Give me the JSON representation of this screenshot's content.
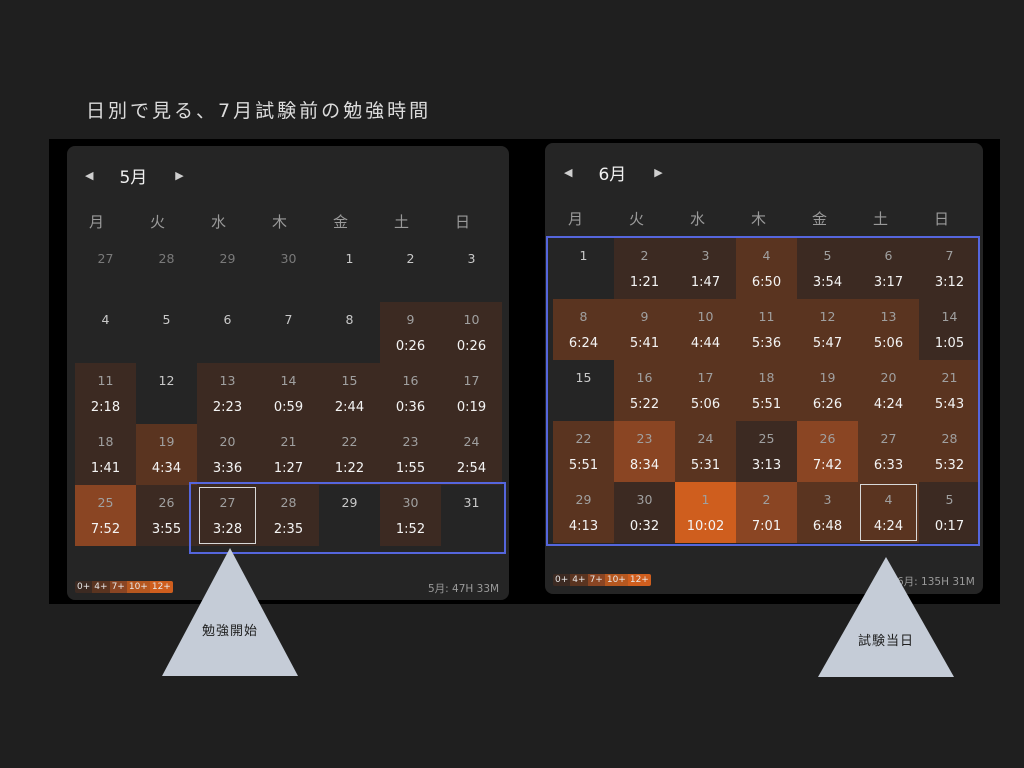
{
  "title": "日別で見る、7月試験前の勉強時間",
  "weekdays": [
    "月",
    "火",
    "水",
    "木",
    "金",
    "土",
    "日"
  ],
  "colors": {
    "lvl1": "#3c2a22",
    "lvl2": "#5a3420",
    "lvl3": "#8a4523",
    "lvl4": "#b5571f",
    "lvl5": "#cf5e1e",
    "highlight": "#5566dd",
    "triangle": "#c5ccd7"
  },
  "legend_labels": [
    "0+",
    "4+",
    "7+",
    "10+",
    "12+"
  ],
  "may": {
    "month_label": "5月",
    "total": "5月: 47H 33M",
    "weeks": [
      [
        {
          "d": "27",
          "o": true
        },
        {
          "d": "28",
          "o": true
        },
        {
          "d": "29",
          "o": true
        },
        {
          "d": "30",
          "o": true
        },
        {
          "d": "1"
        },
        {
          "d": "2"
        },
        {
          "d": "3"
        }
      ],
      [
        {
          "d": "4"
        },
        {
          "d": "5"
        },
        {
          "d": "6"
        },
        {
          "d": "7"
        },
        {
          "d": "8"
        },
        {
          "d": "9",
          "t": "0:26",
          "l": 1
        },
        {
          "d": "10",
          "t": "0:26",
          "l": 1
        }
      ],
      [
        {
          "d": "11",
          "t": "2:18",
          "l": 1
        },
        {
          "d": "12"
        },
        {
          "d": "13",
          "t": "2:23",
          "l": 1
        },
        {
          "d": "14",
          "t": "0:59",
          "l": 1
        },
        {
          "d": "15",
          "t": "2:44",
          "l": 1
        },
        {
          "d": "16",
          "t": "0:36",
          "l": 1
        },
        {
          "d": "17",
          "t": "0:19",
          "l": 1
        }
      ],
      [
        {
          "d": "18",
          "t": "1:41",
          "l": 1
        },
        {
          "d": "19",
          "t": "4:34",
          "l": 2
        },
        {
          "d": "20",
          "t": "3:36",
          "l": 1
        },
        {
          "d": "21",
          "t": "1:27",
          "l": 1
        },
        {
          "d": "22",
          "t": "1:22",
          "l": 1
        },
        {
          "d": "23",
          "t": "1:55",
          "l": 1
        },
        {
          "d": "24",
          "t": "2:54",
          "l": 1
        }
      ],
      [
        {
          "d": "25",
          "t": "7:52",
          "l": 3
        },
        {
          "d": "26",
          "t": "3:55",
          "l": 1
        },
        {
          "d": "27",
          "t": "3:28",
          "l": 1,
          "m": true
        },
        {
          "d": "28",
          "t": "2:35",
          "l": 1
        },
        {
          "d": "29"
        },
        {
          "d": "30",
          "t": "1:52",
          "l": 1
        },
        {
          "d": "31"
        }
      ]
    ]
  },
  "june": {
    "month_label": "6月",
    "total": "6月: 135H 31M",
    "weeks": [
      [
        {
          "d": "1"
        },
        {
          "d": "2",
          "t": "1:21",
          "l": 1
        },
        {
          "d": "3",
          "t": "1:47",
          "l": 1
        },
        {
          "d": "4",
          "t": "6:50",
          "l": 2
        },
        {
          "d": "5",
          "t": "3:54",
          "l": 1
        },
        {
          "d": "6",
          "t": "3:17",
          "l": 1
        },
        {
          "d": "7",
          "t": "3:12",
          "l": 1
        }
      ],
      [
        {
          "d": "8",
          "t": "6:24",
          "l": 2
        },
        {
          "d": "9",
          "t": "5:41",
          "l": 2
        },
        {
          "d": "10",
          "t": "4:44",
          "l": 2
        },
        {
          "d": "11",
          "t": "5:36",
          "l": 2
        },
        {
          "d": "12",
          "t": "5:47",
          "l": 2
        },
        {
          "d": "13",
          "t": "5:06",
          "l": 2
        },
        {
          "d": "14",
          "t": "1:05",
          "l": 1
        }
      ],
      [
        {
          "d": "15"
        },
        {
          "d": "16",
          "t": "5:22",
          "l": 2
        },
        {
          "d": "17",
          "t": "5:06",
          "l": 2
        },
        {
          "d": "18",
          "t": "5:51",
          "l": 2
        },
        {
          "d": "19",
          "t": "6:26",
          "l": 2
        },
        {
          "d": "20",
          "t": "4:24",
          "l": 2
        },
        {
          "d": "21",
          "t": "5:43",
          "l": 2
        }
      ],
      [
        {
          "d": "22",
          "t": "5:51",
          "l": 2
        },
        {
          "d": "23",
          "t": "8:34",
          "l": 3
        },
        {
          "d": "24",
          "t": "5:31",
          "l": 2
        },
        {
          "d": "25",
          "t": "3:13",
          "l": 1
        },
        {
          "d": "26",
          "t": "7:42",
          "l": 3
        },
        {
          "d": "27",
          "t": "6:33",
          "l": 2
        },
        {
          "d": "28",
          "t": "5:32",
          "l": 2
        }
      ],
      [
        {
          "d": "29",
          "t": "4:13",
          "l": 2
        },
        {
          "d": "30",
          "t": "0:32",
          "l": 1
        },
        {
          "d": "1",
          "t": "10:02",
          "l": 5,
          "n": true
        },
        {
          "d": "2",
          "t": "7:01",
          "l": 3,
          "n": true
        },
        {
          "d": "3",
          "t": "6:48",
          "l": 2,
          "n": true
        },
        {
          "d": "4",
          "t": "4:24",
          "l": 2,
          "n": true,
          "m": true
        },
        {
          "d": "5",
          "t": "0:17",
          "l": 1,
          "n": true
        }
      ]
    ]
  },
  "annotations": {
    "start_label": "勉強開始",
    "exam_label": "試験当日"
  }
}
